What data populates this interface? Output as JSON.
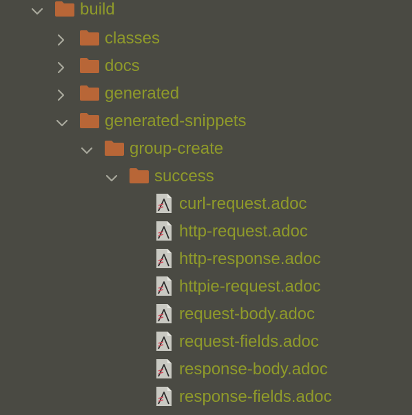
{
  "colors": {
    "background": "#4a4a43",
    "label": "#8f9a2a",
    "folder": "#b86637",
    "chevron": "#a8a89c",
    "file_icon": "#c9c9c2"
  },
  "tree": {
    "build": {
      "label": "build",
      "icon": "folder-icon",
      "expanded": true
    },
    "classes": {
      "label": "classes",
      "icon": "folder-icon",
      "expanded": false
    },
    "docs": {
      "label": "docs",
      "icon": "folder-icon",
      "expanded": false
    },
    "generated": {
      "label": "generated",
      "icon": "folder-icon",
      "expanded": false
    },
    "generated_snippets": {
      "label": "generated-snippets",
      "icon": "folder-icon",
      "expanded": true
    },
    "group_create": {
      "label": "group-create",
      "icon": "folder-icon",
      "expanded": true
    },
    "success": {
      "label": "success",
      "icon": "folder-icon",
      "expanded": true
    },
    "files": [
      {
        "label": "curl-request.adoc",
        "icon": "asciidoc-file-icon"
      },
      {
        "label": "http-request.adoc",
        "icon": "asciidoc-file-icon"
      },
      {
        "label": "http-response.adoc",
        "icon": "asciidoc-file-icon"
      },
      {
        "label": "httpie-request.adoc",
        "icon": "asciidoc-file-icon"
      },
      {
        "label": "request-body.adoc",
        "icon": "asciidoc-file-icon"
      },
      {
        "label": "request-fields.adoc",
        "icon": "asciidoc-file-icon"
      },
      {
        "label": "response-body.adoc",
        "icon": "asciidoc-file-icon"
      },
      {
        "label": "response-fields.adoc",
        "icon": "asciidoc-file-icon"
      }
    ]
  }
}
